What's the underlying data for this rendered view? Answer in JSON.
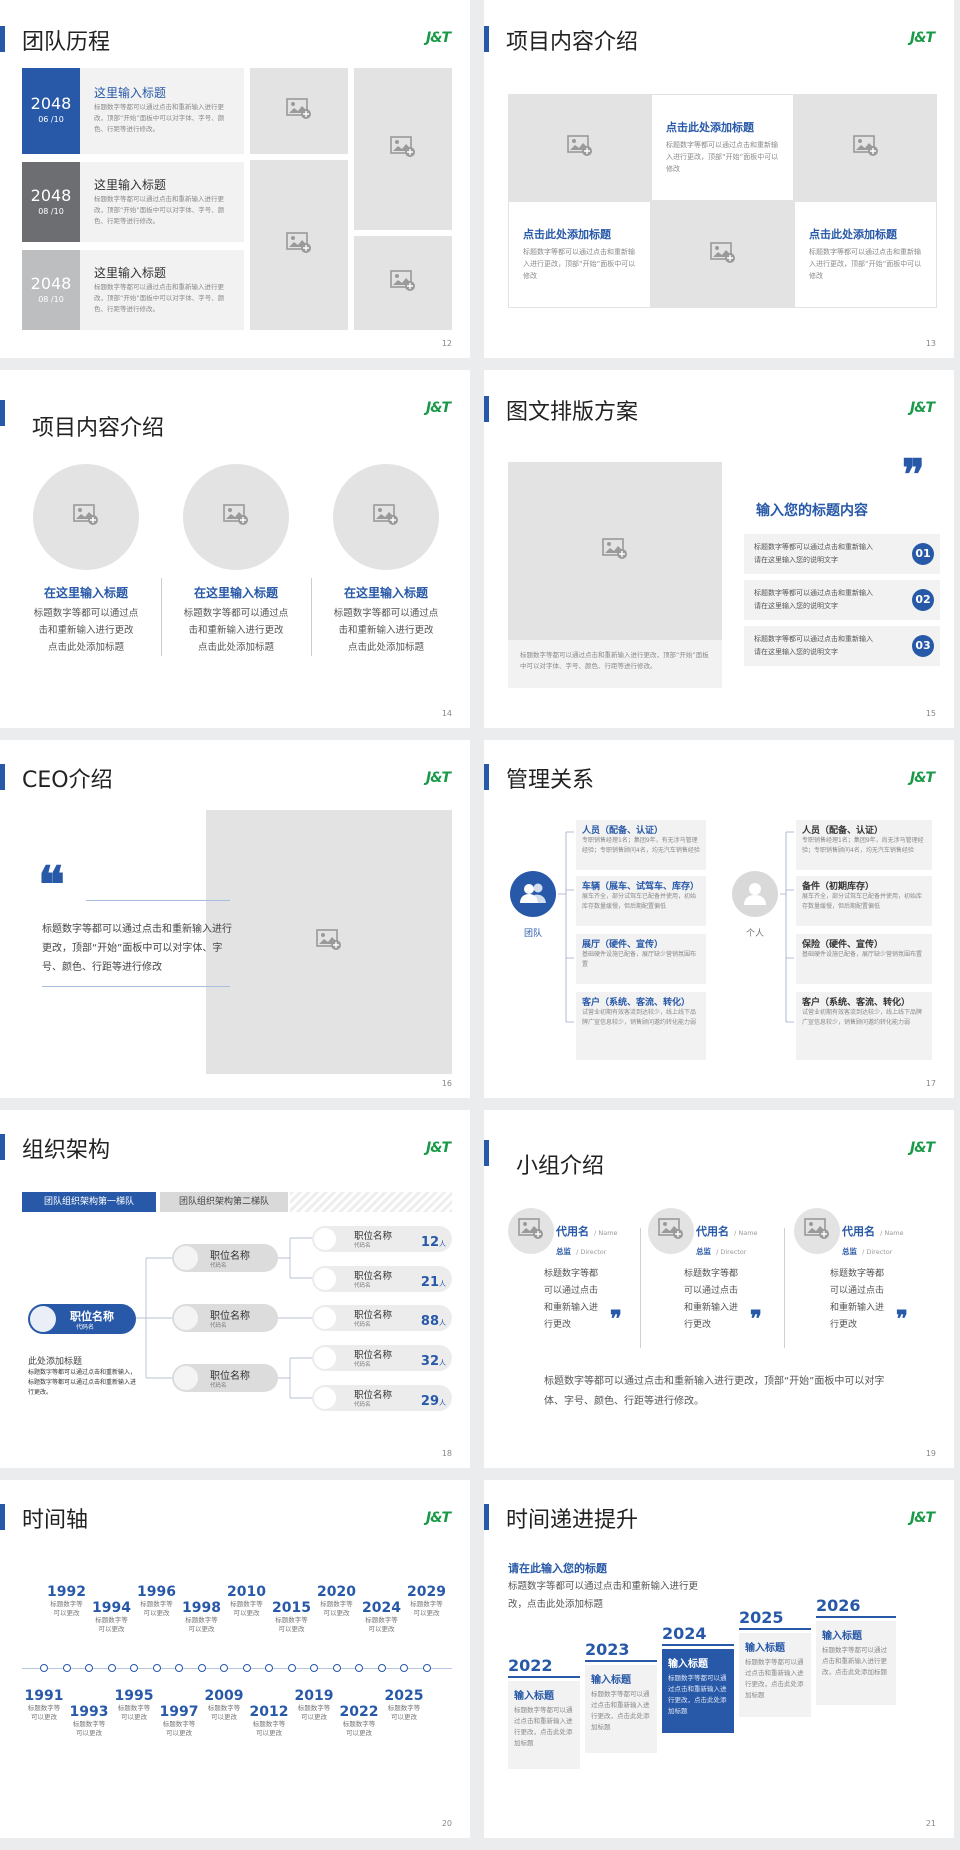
{
  "logo": {
    "a": "J",
    "b": "&",
    "c": "T"
  },
  "s12": {
    "title": "团队历程",
    "page": "12",
    "rows": [
      {
        "year": "2048",
        "date": "06 /10",
        "head": "这里输入标题",
        "body": "标题数字等都可以通过点击和重新输入进行更改，顶部“开始”面板中可以对字体、字号、颜色、行距等进行修改。"
      },
      {
        "year": "2048",
        "date": "08 /10",
        "head": "这里输入标题",
        "body": "标题数字等都可以通过点击和重新输入进行更改，顶部“开始”面板中可以对字体、字号、颜色、行距等进行修改。"
      },
      {
        "year": "2048",
        "date": "08 /10",
        "head": "这里输入标题",
        "body": "标题数字等都可以通过点击和重新输入进行更改，顶部“开始”面板中可以对字体、字号、颜色、行距等进行修改。"
      }
    ]
  },
  "s13": {
    "title": "项目内容介绍",
    "page": "13",
    "c1": {
      "head": "点击此处添加标题",
      "body": "标题数字等都可以通过点击和重新输入进行更改，顶部“开始”面板中可以修改"
    },
    "c2": {
      "head": "点击此处添加标题",
      "body": "标题数字等都可以通过点击和重新输入进行更改，顶部“开始”面板中可以修改"
    },
    "c3": {
      "head": "点击此处添加标题",
      "body": "标题数字等都可以通过点击和重新输入进行更改，顶部“开始”面板中可以修改"
    }
  },
  "s14": {
    "title": "项目内容介绍",
    "page": "14",
    "items": [
      {
        "head": "在这里输入标题",
        "l1": "标题数字等都可以通过点",
        "l2": "击和重新输入进行更改",
        "l3": "点击此处添加标题"
      },
      {
        "head": "在这里输入标题",
        "l1": "标题数字等都可以通过点",
        "l2": "击和重新输入进行更改",
        "l3": "点击此处添加标题"
      },
      {
        "head": "在这里输入标题",
        "l1": "标题数字等都可以通过点",
        "l2": "击和重新输入进行更改",
        "l3": "点击此处添加标题"
      }
    ]
  },
  "s15": {
    "title": "图文排版方案",
    "page": "15",
    "quote": "❞",
    "head": "输入您的标题内容",
    "caption": "标题数字等都可以通过点击和重新输入进行更改，顶部“开始”面板中可以对字体、字号、颜色、行距等进行修改。",
    "items": [
      {
        "a": "标题数字等都可以通过点击和重新输入",
        "b": "请在这里输入您的说明文字",
        "n": "01"
      },
      {
        "a": "标题数字等都可以通过点击和重新输入",
        "b": "请在这里输入您的说明文字",
        "n": "02"
      },
      {
        "a": "标题数字等都可以通过点击和重新输入",
        "b": "请在这里输入您的说明文字",
        "n": "03"
      }
    ]
  },
  "s16": {
    "title": "CEO介绍",
    "page": "16",
    "quote": "❝",
    "body": "标题数字等都可以通过点击和重新输入进行更改，顶部“开始”面板中可以对字体、字号、颜色、行距等进行修改"
  },
  "s17": {
    "title": "管理关系",
    "page": "17",
    "team": "团队",
    "person": "个人",
    "left": [
      {
        "head": "人员（配备、认证）",
        "body": "专职销售经理1名；集团9年，有无涉马管理经验；专职销售顾问4名，均无汽车销售经验"
      },
      {
        "head": "车辆（展车、试驾车、库存）",
        "body": "展车齐全，部分试驾车已配备并使用，初始库存数量缓慢，但后期配置偏低"
      },
      {
        "head": "展厅（硬件、宣传）",
        "body": "基础硬件设施已配备，展厅缺少营销氛围布置"
      },
      {
        "head": "客户（系统、客流、转化）",
        "body": "试营业初期有效客流到达较少，线上线下品牌广宣信息较少，销售顾问邀约转化能力弱"
      }
    ],
    "right": [
      {
        "head": "人员（配备、认证）",
        "body": "专职销售经理1名；集团9年，尚无涉马管理经验；专职销售顾问4名，均无汽车销售经验"
      },
      {
        "head": "备件（初期库存）",
        "body": "展车齐全，部分试驾车已配备并使用，初始库存数量缓慢，但后期配置偏低"
      },
      {
        "head": "保险（硬件、宣传）",
        "body": "基础硬件设施已配备，展厅缺少营销氛围布置"
      },
      {
        "head": "客户（系统、客流、转化）",
        "body": "试营业初期有效客流到达较少，线上线下品牌广宣信息较少，销售顾问邀约转化能力弱"
      }
    ]
  },
  "s18": {
    "title": "组织架构",
    "page": "18",
    "tab1": "团队组织架构第一梯队",
    "tab2": "团队组织架构第二梯队",
    "root": {
      "name": "职位名称",
      "sub": "代码名"
    },
    "note_head": "此处添加标题",
    "note_body": "标题数字等都可以通过点击和重新输入，标题数字等都可以通过点击和重新输入进行更改。",
    "mid": [
      {
        "name": "职位名称",
        "sub": "代码名"
      },
      {
        "name": "职位名称",
        "sub": "代码名"
      },
      {
        "name": "职位名称",
        "sub": "代码名"
      }
    ],
    "leaves": [
      {
        "name": "职位名称",
        "sub": "代码名",
        "n": "12",
        "u": "人"
      },
      {
        "name": "职位名称",
        "sub": "代码名",
        "n": "21",
        "u": "人"
      },
      {
        "name": "职位名称",
        "sub": "代码名",
        "n": "88",
        "u": "人"
      },
      {
        "name": "职位名称",
        "sub": "代码名",
        "n": "32",
        "u": "人"
      },
      {
        "name": "职位名称",
        "sub": "代码名",
        "n": "29",
        "u": "人"
      }
    ]
  },
  "s19": {
    "title": "小组介绍",
    "page": "19",
    "members": [
      {
        "name": "代用名",
        "ename": "/ Name",
        "role": "总监",
        "erole": "/ Director",
        "body": "标题数字等都可以通过点击和重新输入进行更改"
      },
      {
        "name": "代用名",
        "ename": "/ Name",
        "role": "总监",
        "erole": "/ Director",
        "body": "标题数字等都可以通过点击和重新输入进行更改"
      },
      {
        "name": "代用名",
        "ename": "/ Name",
        "role": "总监",
        "erole": "/ Director",
        "body": "标题数字等都可以通过点击和重新输入进行更改"
      }
    ],
    "quote": "❞",
    "footer": "标题数字等都可以通过点击和重新输入进行更改，顶部“开始”面板中可以对字体、字号、颜色、行距等进行修改。"
  },
  "s20": {
    "title": "时间轴",
    "page": "20",
    "desc1": "标题数字等",
    "desc2": "可以更改",
    "top": [
      "1992",
      "1994",
      "1996",
      "1998",
      "2010",
      "2015",
      "2020",
      "2024",
      "2029"
    ],
    "bottom": [
      "1991",
      "1993",
      "1995",
      "1997",
      "2009",
      "2012",
      "2019",
      "2022",
      "2025"
    ]
  },
  "s21": {
    "title": "时间递进提升",
    "page": "21",
    "head": "请在此输入您的标题",
    "body": "标题数字等都可以通过点击和重新输入进行更改，点击此处添加标题",
    "steps": [
      {
        "year": "2022",
        "head": "输入标题",
        "body": "标题数字等都可以通过点击和重新输入进行更改，点击此处添加标题"
      },
      {
        "year": "2023",
        "head": "输入标题",
        "body": "标题数字等都可以通过点击和重新输入进行更改，点击此处添加标题"
      },
      {
        "year": "2024",
        "head": "输入标题",
        "body": "标题数字等都可以通过点击和重新输入进行更改，点击此处添加标题"
      },
      {
        "year": "2025",
        "head": "输入标题",
        "body": "标题数字等都可以通过点击和重新输入进行更改，点击此处添加标题"
      },
      {
        "year": "2026",
        "head": "输入标题",
        "body": "标题数字等都可以通过点击和重新输入进行更改，点击此处添加标题"
      }
    ]
  }
}
